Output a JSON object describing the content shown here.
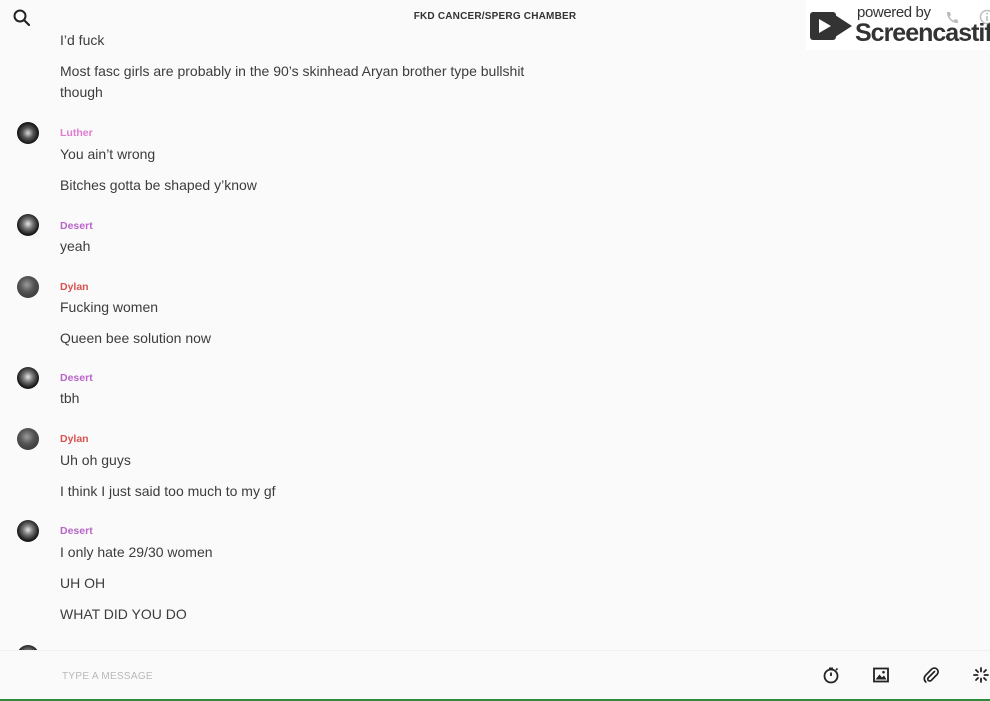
{
  "header": {
    "title": "FKD CANCER/SPERG CHAMBER"
  },
  "watermark": {
    "powered_by": "powered by",
    "brand": "Screencastify"
  },
  "messages": [
    {
      "text": "I’d fuck"
    },
    {
      "text": "Most fasc girls are probably in the 90’s skinhead Aryan brother type bullshit though"
    },
    {
      "sender": "Luther",
      "color": "#e07bd0"
    },
    {
      "text": "You ain’t wrong"
    },
    {
      "text": "Bitches gotta be shaped y’know"
    },
    {
      "sender": "Desert",
      "color": "#b864c8"
    },
    {
      "text": "yeah"
    },
    {
      "sender": "Dylan",
      "color": "#d9534f"
    },
    {
      "text": "Fucking women"
    },
    {
      "text": "Queen bee solution now"
    },
    {
      "sender": "Desert",
      "color": "#b864c8"
    },
    {
      "text": "tbh"
    },
    {
      "sender": "Dylan",
      "color": "#d9534f"
    },
    {
      "text": "Uh oh guys"
    },
    {
      "text": "I think I just said too much to my gf"
    },
    {
      "sender": "Desert",
      "color": "#b864c8"
    },
    {
      "text": "I only hate 29/30 women"
    },
    {
      "text": "UH OH"
    },
    {
      "text": "WHAT DID YOU DO"
    }
  ],
  "composer": {
    "placeholder": "TYPE A MESSAGE",
    "tools": [
      "timer-icon",
      "image-icon",
      "attachment-icon",
      "sparkle-icon"
    ]
  },
  "colors": {
    "luther": "#e07bd0",
    "desert": "#b864c8",
    "dylan": "#d9534f",
    "bottom_accent": "#2e8b3c"
  }
}
